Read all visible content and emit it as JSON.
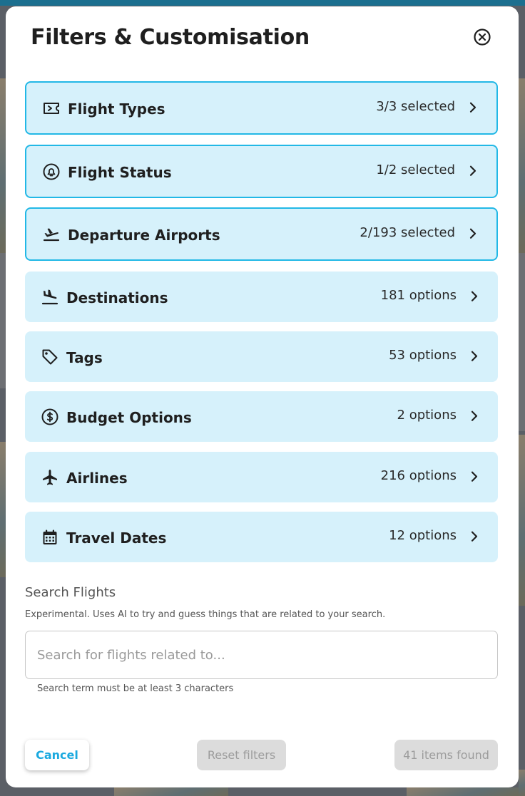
{
  "modal": {
    "title": "Filters & Customisation",
    "close_icon": "close-circle-icon"
  },
  "filters": [
    {
      "label": "Flight Types",
      "count": "3/3 selected",
      "icon": "ticket-icon",
      "selected": true
    },
    {
      "label": "Flight Status",
      "count": "1/2 selected",
      "icon": "bell-circle-icon",
      "selected": true
    },
    {
      "label": "Departure Airports",
      "count": "2/193 selected",
      "icon": "flight-takeoff-icon",
      "selected": true
    },
    {
      "label": "Destinations",
      "count": "181 options",
      "icon": "flight-land-icon",
      "selected": false
    },
    {
      "label": "Tags",
      "count": "53 options",
      "icon": "tag-icon",
      "selected": false
    },
    {
      "label": "Budget Options",
      "count": "2 options",
      "icon": "dollar-circle-icon",
      "selected": false
    },
    {
      "label": "Airlines",
      "count": "216 options",
      "icon": "airplane-icon",
      "selected": false
    },
    {
      "label": "Travel Dates",
      "count": "12 options",
      "icon": "calendar-icon",
      "selected": false
    }
  ],
  "search": {
    "heading": "Search Flights",
    "hint": "Experimental. Uses AI to try and guess things that are related to your search.",
    "placeholder": "Search for flights related to...",
    "value": "",
    "helper": "Search term must be at least 3 characters"
  },
  "footer": {
    "cancel_label": "Cancel",
    "reset_label": "Reset filters",
    "found_label": "41 items found"
  },
  "colors": {
    "row_bg": "#d6f1fb",
    "selected_border": "#22b8e6",
    "accent": "#1aa9df",
    "disabled_bg": "#dcdcdc"
  }
}
